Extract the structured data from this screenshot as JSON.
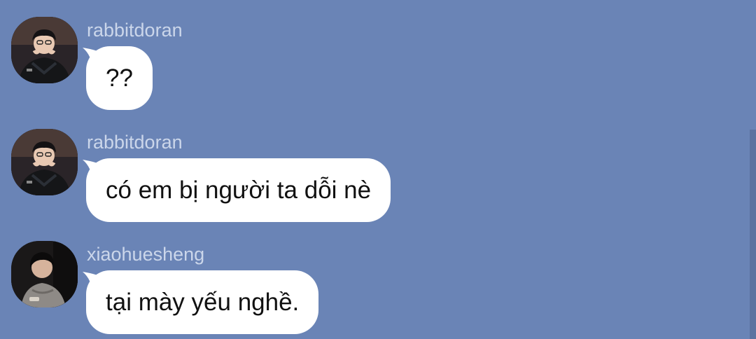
{
  "chat": {
    "background_color": "#6a84b6",
    "messages": [
      {
        "username": "rabbitdoran",
        "text": "??",
        "avatar_icon": "user-avatar-photo"
      },
      {
        "username": "rabbitdoran",
        "text": "có em bị người ta dỗi nè",
        "avatar_icon": "user-avatar-photo"
      },
      {
        "username": "xiaohuesheng",
        "text": "tại mày yếu nghề.",
        "avatar_icon": "user-avatar-photo"
      }
    ]
  }
}
